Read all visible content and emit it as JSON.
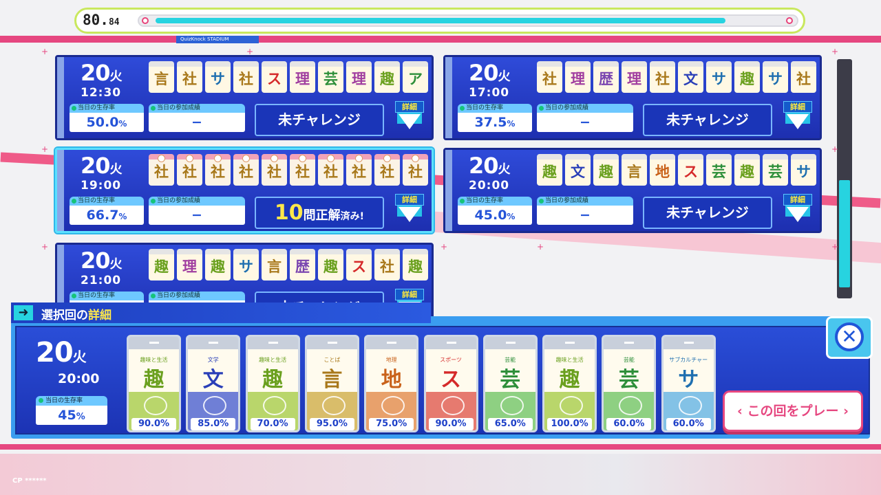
{
  "colors": {
    "accent": "#e64780",
    "cyan": "#27d3e0",
    "card_blue": "#2f4bd9",
    "label_blue": "#6ec8ff"
  },
  "header": {
    "score": "80.",
    "score_small": "84",
    "progress_percent": 90,
    "subtitle": "QuizKnock STADIUM"
  },
  "labels": {
    "survival": "当日の生存率",
    "result": "当日の参加成績",
    "detail": "詳細",
    "weekday": "火"
  },
  "cards": [
    {
      "day": "20",
      "time": "12:30",
      "survival": "50.0",
      "survival_unit": "%",
      "result": "−",
      "button": "未チャレンジ",
      "done": false,
      "tiles": [
        {
          "c": "言",
          "col": "#a8781a"
        },
        {
          "c": "社",
          "col": "#a8781a"
        },
        {
          "c": "サ",
          "col": "#1f6fb0"
        },
        {
          "c": "社",
          "col": "#a8781a"
        },
        {
          "c": "ス",
          "col": "#d52a2a"
        },
        {
          "c": "理",
          "col": "#a13fa0"
        },
        {
          "c": "芸",
          "col": "#2e8f3a"
        },
        {
          "c": "理",
          "col": "#a13fa0"
        },
        {
          "c": "趣",
          "col": "#6aa01e"
        },
        {
          "c": "ア",
          "col": "#2e8f3a"
        }
      ]
    },
    {
      "day": "20",
      "time": "17:00",
      "survival": "37.5",
      "survival_unit": "%",
      "result": "−",
      "button": "未チャレンジ",
      "done": false,
      "tiles": [
        {
          "c": "社",
          "col": "#a8781a"
        },
        {
          "c": "理",
          "col": "#a13fa0"
        },
        {
          "c": "歴",
          "col": "#7a45b0"
        },
        {
          "c": "理",
          "col": "#a13fa0"
        },
        {
          "c": "社",
          "col": "#a8781a"
        },
        {
          "c": "文",
          "col": "#2a3fb8"
        },
        {
          "c": "サ",
          "col": "#1f6fb0"
        },
        {
          "c": "趣",
          "col": "#6aa01e"
        },
        {
          "c": "サ",
          "col": "#1f6fb0"
        },
        {
          "c": "社",
          "col": "#a8781a"
        }
      ]
    },
    {
      "day": "20",
      "time": "19:00",
      "survival": "66.7",
      "survival_unit": "%",
      "result": "−",
      "button": "10",
      "button_suffix": "問正解",
      "button_tail": "済み!",
      "done": true,
      "tiles": [
        {
          "c": "社",
          "col": "#a8781a"
        },
        {
          "c": "社",
          "col": "#a8781a"
        },
        {
          "c": "社",
          "col": "#a8781a"
        },
        {
          "c": "社",
          "col": "#a8781a"
        },
        {
          "c": "社",
          "col": "#a8781a"
        },
        {
          "c": "社",
          "col": "#a8781a"
        },
        {
          "c": "社",
          "col": "#a8781a"
        },
        {
          "c": "社",
          "col": "#a8781a"
        },
        {
          "c": "社",
          "col": "#a8781a"
        },
        {
          "c": "社",
          "col": "#a8781a"
        }
      ]
    },
    {
      "day": "20",
      "time": "20:00",
      "survival": "45.0",
      "survival_unit": "%",
      "result": "−",
      "button": "未チャレンジ",
      "done": false,
      "tiles": [
        {
          "c": "趣",
          "col": "#6aa01e"
        },
        {
          "c": "文",
          "col": "#2a3fb8"
        },
        {
          "c": "趣",
          "col": "#6aa01e"
        },
        {
          "c": "言",
          "col": "#a8781a"
        },
        {
          "c": "地",
          "col": "#c9621a"
        },
        {
          "c": "ス",
          "col": "#d52a2a"
        },
        {
          "c": "芸",
          "col": "#2e8f3a"
        },
        {
          "c": "趣",
          "col": "#6aa01e"
        },
        {
          "c": "芸",
          "col": "#2e8f3a"
        },
        {
          "c": "サ",
          "col": "#1f6fb0"
        }
      ]
    },
    {
      "day": "20",
      "time": "21:00",
      "survival": "",
      "survival_unit": "",
      "result": "−",
      "button": "未チャレンジ",
      "done": false,
      "tiles": [
        {
          "c": "趣",
          "col": "#6aa01e"
        },
        {
          "c": "理",
          "col": "#a13fa0"
        },
        {
          "c": "趣",
          "col": "#6aa01e"
        },
        {
          "c": "サ",
          "col": "#1f6fb0"
        },
        {
          "c": "言",
          "col": "#a8781a"
        },
        {
          "c": "歴",
          "col": "#7a45b0"
        },
        {
          "c": "趣",
          "col": "#6aa01e"
        },
        {
          "c": "ス",
          "col": "#d52a2a"
        },
        {
          "c": "社",
          "col": "#a8781a"
        },
        {
          "c": "趣",
          "col": "#6aa01e"
        }
      ]
    }
  ],
  "panel": {
    "title_prefix": "選択回の",
    "title_emph": "詳細",
    "day": "20",
    "weekday": "火",
    "time": "20:00",
    "survival_label": "当日の生存率",
    "survival": "45",
    "survival_unit": "%",
    "play_button": "この回をプレー",
    "questions": [
      {
        "cat": "趣味と生活",
        "kan": "趣",
        "pct": "90.0%",
        "col": "#6aa01e",
        "bg": "#b9d66b"
      },
      {
        "cat": "文学",
        "kan": "文",
        "pct": "85.0%",
        "col": "#2a3fb8",
        "bg": "#6f7fd6"
      },
      {
        "cat": "趣味と生活",
        "kan": "趣",
        "pct": "70.0%",
        "col": "#6aa01e",
        "bg": "#b9d66b"
      },
      {
        "cat": "ことば",
        "kan": "言",
        "pct": "95.0%",
        "col": "#a8781a",
        "bg": "#d9bd6a"
      },
      {
        "cat": "地理",
        "kan": "地",
        "pct": "75.0%",
        "col": "#c9621a",
        "bg": "#e8a16c"
      },
      {
        "cat": "スポーツ",
        "kan": "ス",
        "pct": "90.0%",
        "col": "#d52a2a",
        "bg": "#e67a6f"
      },
      {
        "cat": "芸能",
        "kan": "芸",
        "pct": "65.0%",
        "col": "#2e8f3a",
        "bg": "#8ed082"
      },
      {
        "cat": "趣味と生活",
        "kan": "趣",
        "pct": "100.0%",
        "col": "#6aa01e",
        "bg": "#b9d66b"
      },
      {
        "cat": "芸能",
        "kan": "芸",
        "pct": "60.0%",
        "col": "#2e8f3a",
        "bg": "#8ed082"
      },
      {
        "cat": "サブカルチャー",
        "kan": "サ",
        "pct": "60.0%",
        "col": "#1f6fb0",
        "bg": "#83c2e6"
      }
    ]
  },
  "footer": {
    "cp": "CP ******"
  }
}
